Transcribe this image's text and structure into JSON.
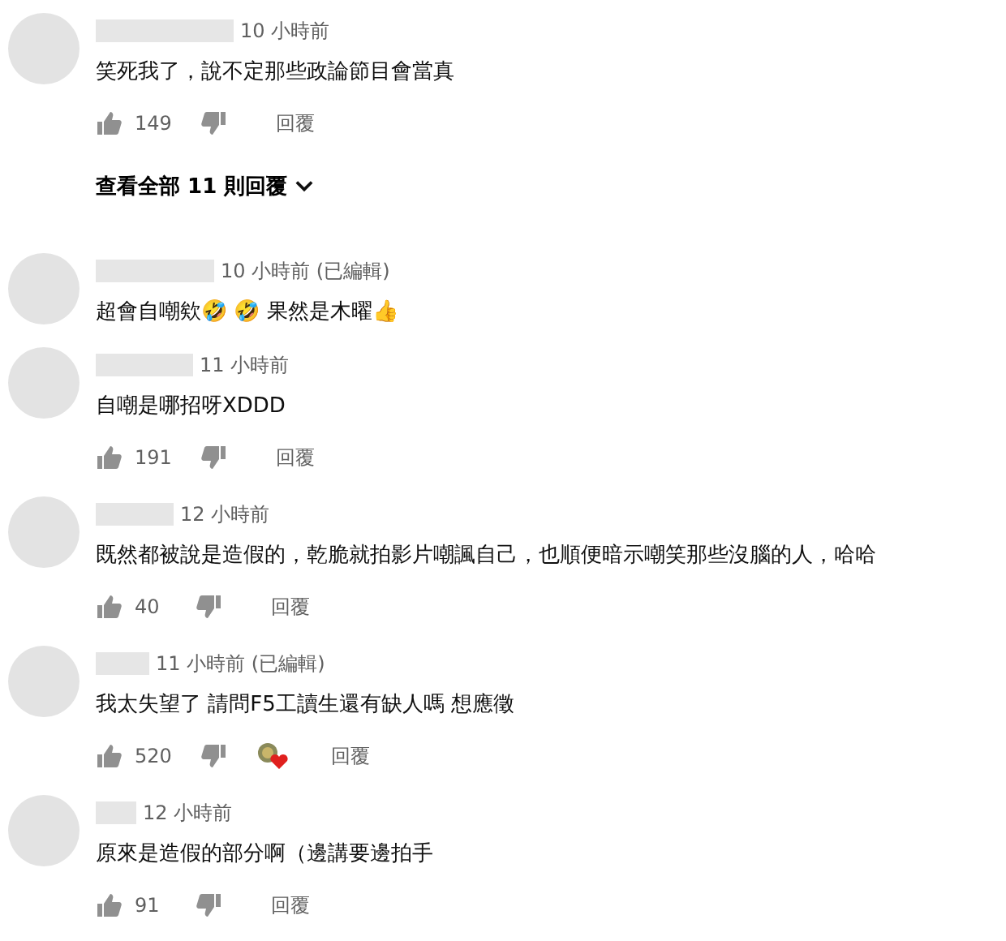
{
  "comments": [
    {
      "time": "10 小時前",
      "text": "笑死我了，說不定那些政論節目會當真",
      "actions": {
        "likes": "149",
        "reply": "回覆",
        "hearted": false
      },
      "view_replies": "查看全部 11 則回覆"
    },
    {
      "time": "10 小時前 (已編輯)",
      "text": "超會自嘲欸🤣 🤣 果然是木曜👍"
    },
    {
      "time": "11 小時前",
      "text": "自嘲是哪招呀XDDD",
      "actions": {
        "likes": "191",
        "reply": "回覆",
        "hearted": false
      }
    },
    {
      "time": "12 小時前",
      "text": "既然都被說是造假的，乾脆就拍影片嘲諷自己，也順便暗示嘲笑那些沒腦的人，哈哈",
      "actions": {
        "likes": "40",
        "reply": "回覆",
        "hearted": false
      }
    },
    {
      "time": "11 小時前 (已編輯)",
      "text": "我太失望了 請問F5工讀生還有缺人嗎 想應徵",
      "actions": {
        "likes": "520",
        "reply": "回覆",
        "hearted": true
      }
    },
    {
      "time": "12 小時前",
      "text": "原來是造假的部分啊（邊講要邊拍手",
      "actions": {
        "likes": "91",
        "reply": "回覆",
        "hearted": false
      }
    }
  ]
}
